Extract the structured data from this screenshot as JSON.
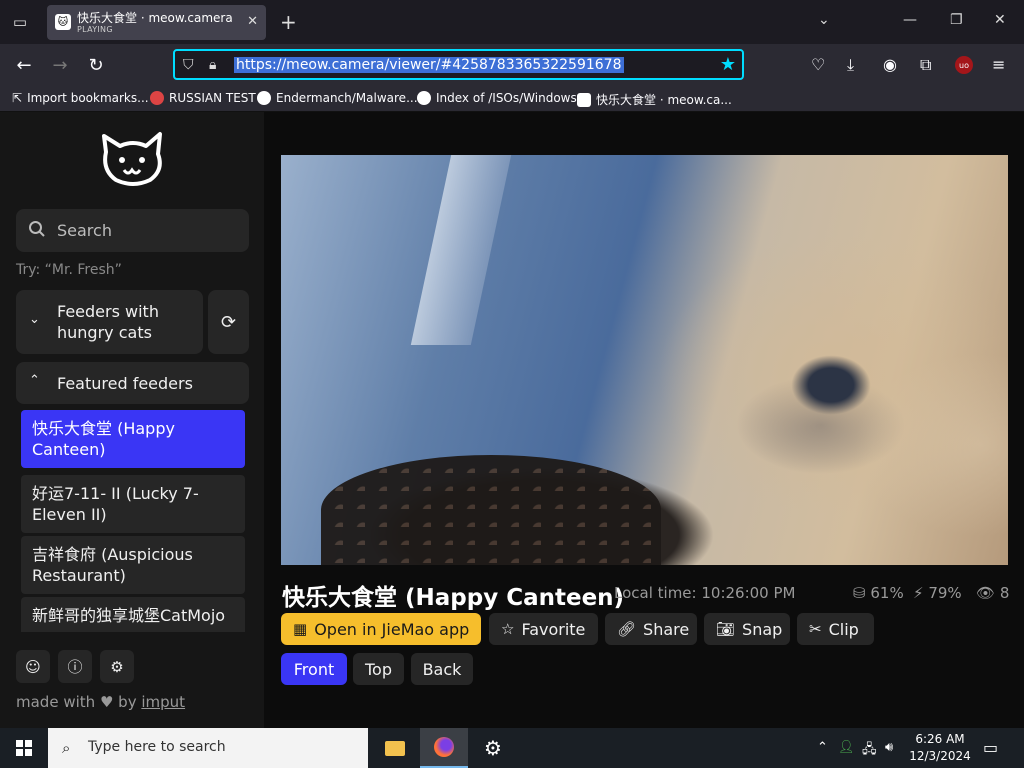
{
  "browser": {
    "tab": {
      "title": "快乐大食堂 · meow.camera",
      "subtitle": "PLAYING"
    },
    "url": "https://meow.camera/viewer/#4258783365322591678",
    "bookmarks": [
      "Import bookmarks...",
      "RUSSIAN TEST",
      "Endermanch/Malware...",
      "Index of /ISOs/Windows",
      "快乐大食堂 · meow.ca..."
    ]
  },
  "sidebar": {
    "search_placeholder": "Search",
    "try_text": "Try: “Mr. Fresh”",
    "group_hungry": "Feeders with hungry cats",
    "group_featured": "Featured feeders",
    "feeders": [
      {
        "label": "快乐大食堂 (Happy Canteen)",
        "active": true
      },
      {
        "label": "好运7-11- II  (Lucky 7-Eleven II)",
        "active": false
      },
      {
        "label": "吉祥食府 (Auspicious Restaurant)",
        "active": false
      },
      {
        "label": "新鲜哥的独享城堡CatMojo",
        "active": false
      }
    ],
    "made_with": "made with",
    "by": "by",
    "author": "imput"
  },
  "viewer": {
    "title": "快乐大食堂 (Happy Canteen)",
    "local_time": "Local time: 10:26:00 PM",
    "food_level": "61%",
    "power_level": "79%",
    "viewers": "8",
    "actions": {
      "open_app": "Open in JieMao app",
      "favorite": "Favorite",
      "share": "Share",
      "snap": "Snap",
      "clip": "Clip"
    },
    "views": {
      "front": "Front",
      "top": "Top",
      "back": "Back",
      "selected": "Front"
    }
  },
  "taskbar": {
    "search_placeholder": "Type here to search",
    "time": "6:26 AM",
    "date": "12/3/2024"
  }
}
